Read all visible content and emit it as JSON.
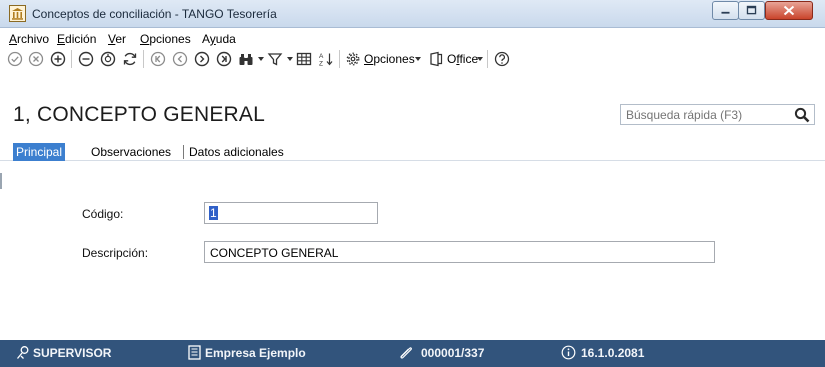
{
  "window": {
    "title": "Conceptos de conciliación - TANGO Tesorería",
    "icon": "building-icon"
  },
  "menu": {
    "archivo": {
      "first": "A",
      "rest": "rchivo"
    },
    "edicion": {
      "first": "E",
      "rest": "dición"
    },
    "ver": {
      "first": "V",
      "rest": "er"
    },
    "opciones": {
      "first": "O",
      "rest": "pciones"
    },
    "ayuda": {
      "pre": "A",
      "u": "y",
      "rest": "uda"
    }
  },
  "toolbar": {
    "opciones": {
      "first": "O",
      "rest": "pciones"
    },
    "office": {
      "pre": "O",
      "u": "f",
      "rest": "fice"
    }
  },
  "header": {
    "record_title": "1, CONCEPTO GENERAL",
    "search_placeholder": "Búsqueda rápida (F3)"
  },
  "tabs": [
    {
      "label": "Principal",
      "active": true
    },
    {
      "label": "Observaciones",
      "active": false
    },
    {
      "label": "Datos adicionales",
      "active": false
    }
  ],
  "form": {
    "codigo_label": "Código:",
    "codigo_value": "1",
    "descripcion_label": "Descripción:",
    "descripcion_value": "CONCEPTO GENERAL"
  },
  "status": {
    "user": "SUPERVISOR",
    "company": "Empresa Ejemplo",
    "record": "000001/337",
    "version": "16.1.0.2081"
  },
  "colors": {
    "status_bar": "#32547c",
    "active_tab": "#3c7fcf",
    "selection": "#3060c8"
  }
}
